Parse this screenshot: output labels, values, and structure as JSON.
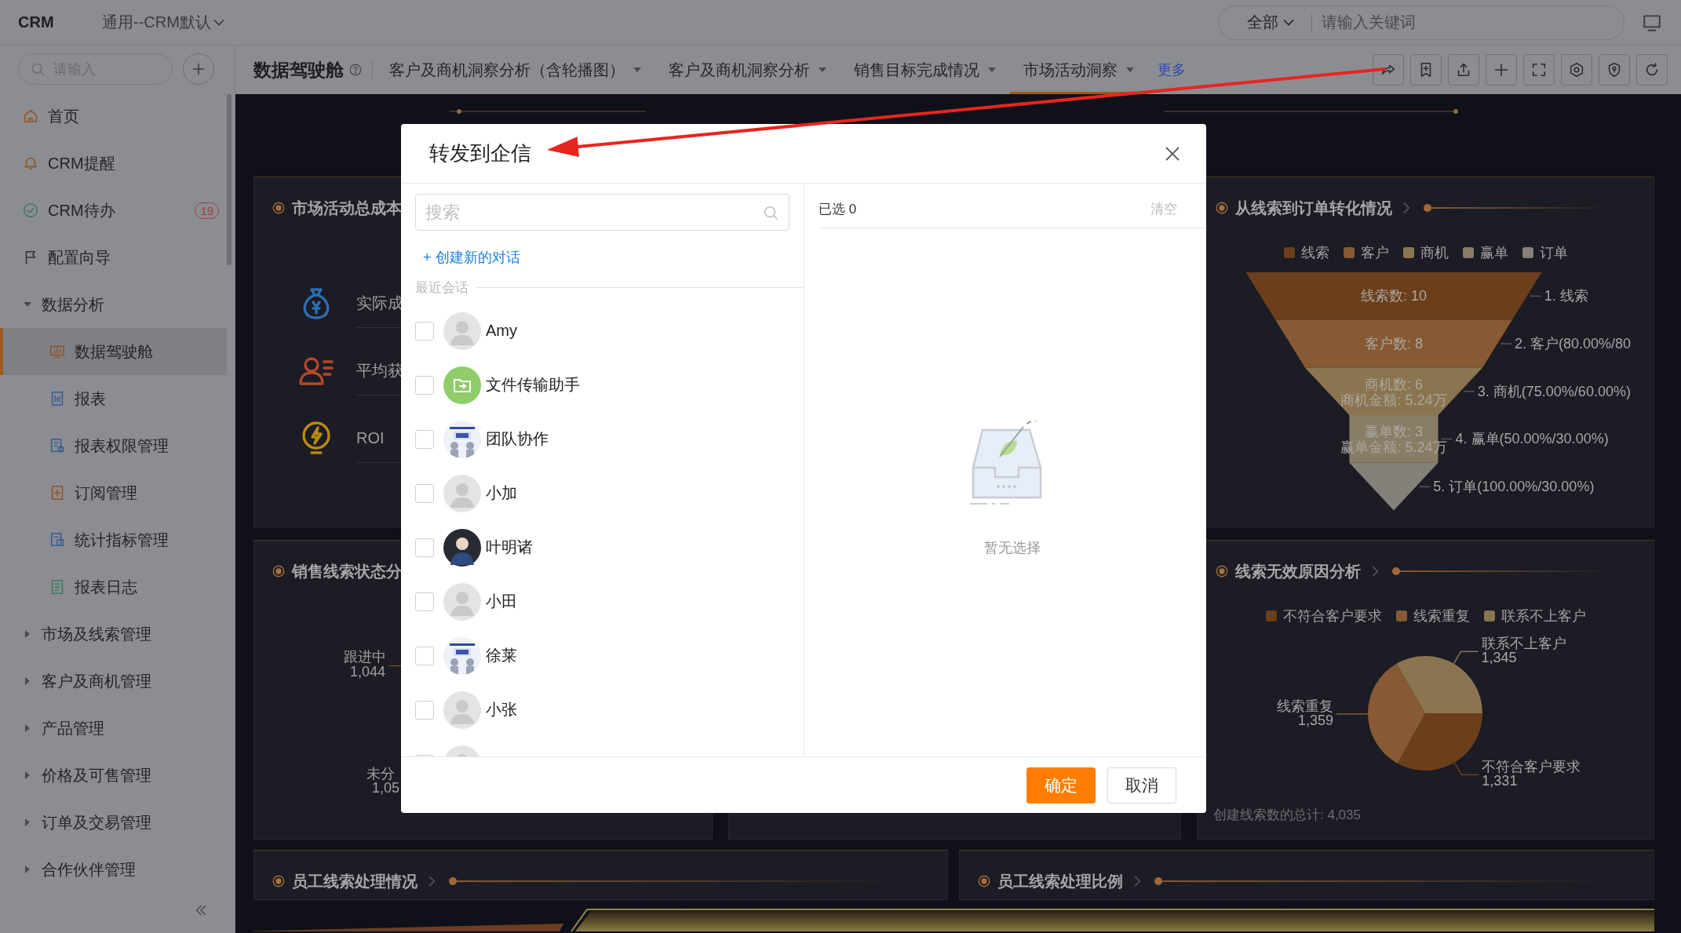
{
  "topbar": {
    "brand": "CRM",
    "workspace": "通用--CRM默认",
    "search_scope": "全部",
    "search_placeholder": "请输入关键词"
  },
  "sidebar": {
    "search_placeholder": "请输入",
    "items": [
      {
        "label": "首页",
        "selected": false
      },
      {
        "label": "CRM提醒",
        "selected": false
      },
      {
        "label": "CRM待办",
        "selected": false,
        "badge": "19"
      },
      {
        "label": "配置向导",
        "selected": false
      },
      {
        "label": "数据分析",
        "selected": false,
        "expanded": true,
        "children": [
          {
            "label": "数据驾驶舱",
            "selected": true
          },
          {
            "label": "报表",
            "selected": false
          },
          {
            "label": "报表权限管理",
            "selected": false
          },
          {
            "label": "订阅管理",
            "selected": false
          },
          {
            "label": "统计指标管理",
            "selected": false
          },
          {
            "label": "报表日志",
            "selected": false
          }
        ]
      },
      {
        "label": "市场及线索管理",
        "selected": false,
        "expanded": false
      },
      {
        "label": "客户及商机管理",
        "selected": false,
        "expanded": false
      },
      {
        "label": "产品管理",
        "selected": false,
        "expanded": false
      },
      {
        "label": "价格及可售管理",
        "selected": false,
        "expanded": false
      },
      {
        "label": "订单及交易管理",
        "selected": false,
        "expanded": false
      },
      {
        "label": "合作伙伴管理",
        "selected": false,
        "expanded": false
      }
    ]
  },
  "tabbar": {
    "title": "数据驾驶舱",
    "tabs": [
      {
        "label": "客户及商机洞察分析（含轮播图）",
        "selected": false
      },
      {
        "label": "客户及商机洞察分析",
        "selected": false
      },
      {
        "label": "销售目标完成情况",
        "selected": false
      },
      {
        "label": "市场活动洞察",
        "selected": true
      }
    ],
    "more": "更多"
  },
  "cost_card": {
    "title": "市场活动总成本",
    "metrics": [
      "实际成",
      "平均获",
      "ROI"
    ]
  },
  "lead_status_card": {
    "title": "销售线索状态分",
    "labels": [
      {
        "name": "跟进中",
        "value": "1,044"
      },
      {
        "name": "未分",
        "value": "1,05"
      }
    ]
  },
  "conversion_card": {
    "title": "从线索到订单转化情况",
    "legend": [
      {
        "label": "线索",
        "color": "#6b3f1b"
      },
      {
        "label": "客户",
        "color": "#875a33"
      },
      {
        "label": "商机",
        "color": "#8b7550"
      },
      {
        "label": "赢单",
        "color": "#8a7d65"
      },
      {
        "label": "订单",
        "color": "#85807a"
      }
    ],
    "stages": [
      {
        "lines": [
          "线索数: 10"
        ],
        "outer": "1. 线索"
      },
      {
        "lines": [
          "客户数: 8"
        ],
        "outer": "2. 客户(80.00%/80"
      },
      {
        "lines": [
          "商机数: 6",
          "商机金额: 5.24万"
        ],
        "outer": "3. 商机(75.00%/60.00%)"
      },
      {
        "lines": [
          "赢单数: 3",
          "赢单金额: 5.24万"
        ],
        "outer": "4. 赢单(50.00%/30.00%)"
      },
      {
        "outer": "5. 订单(100.00%/30.00%)"
      }
    ]
  },
  "invalid_reason_card": {
    "title": "线索无效原因分析",
    "legend": [
      {
        "label": "不符合客户要求",
        "color": "#6b3f1b"
      },
      {
        "label": "线索重复",
        "color": "#875a33"
      },
      {
        "label": "联系不上客户",
        "color": "#8b7550"
      }
    ],
    "chart_data": {
      "type": "pie",
      "categories": [
        "不符合客户要求",
        "线索重复",
        "联系不上客户"
      ],
      "values": [
        1331,
        1359,
        1345
      ],
      "value_labels": [
        "1,331",
        "1,359",
        "1,345"
      ],
      "data_labels": true
    },
    "total": "创建线索数的总计: 4,035"
  },
  "bottom_cards": [
    {
      "title": "员工线索处理情况"
    },
    {
      "title": "员工线索处理比例"
    }
  ],
  "modal": {
    "title": "转发到企信",
    "search_placeholder": "搜索",
    "create_link": "+ 创建新的对话",
    "section": "最近会话",
    "contacts": [
      {
        "name": "Amy",
        "kind": "default",
        "checked": false
      },
      {
        "name": "文件传输助手",
        "kind": "file",
        "checked": false
      },
      {
        "name": "团队协作",
        "kind": "picture",
        "checked": false
      },
      {
        "name": "小加",
        "kind": "default",
        "checked": false
      },
      {
        "name": "叶明诸",
        "checked": false
      },
      {
        "name": "小田",
        "kind": "default",
        "checked": false
      },
      {
        "name": "徐莱",
        "kind": "picture",
        "checked": false
      },
      {
        "name": "小张",
        "kind": "default",
        "checked": false
      },
      {
        "kind": "default",
        "checked": false
      }
    ],
    "selected_label": "已选 0",
    "clear": "清空",
    "empty_text": "暂无选择",
    "buttons": [
      {
        "label": "确定",
        "kind": "primary"
      },
      {
        "label": "取消",
        "kind": "default"
      }
    ]
  }
}
